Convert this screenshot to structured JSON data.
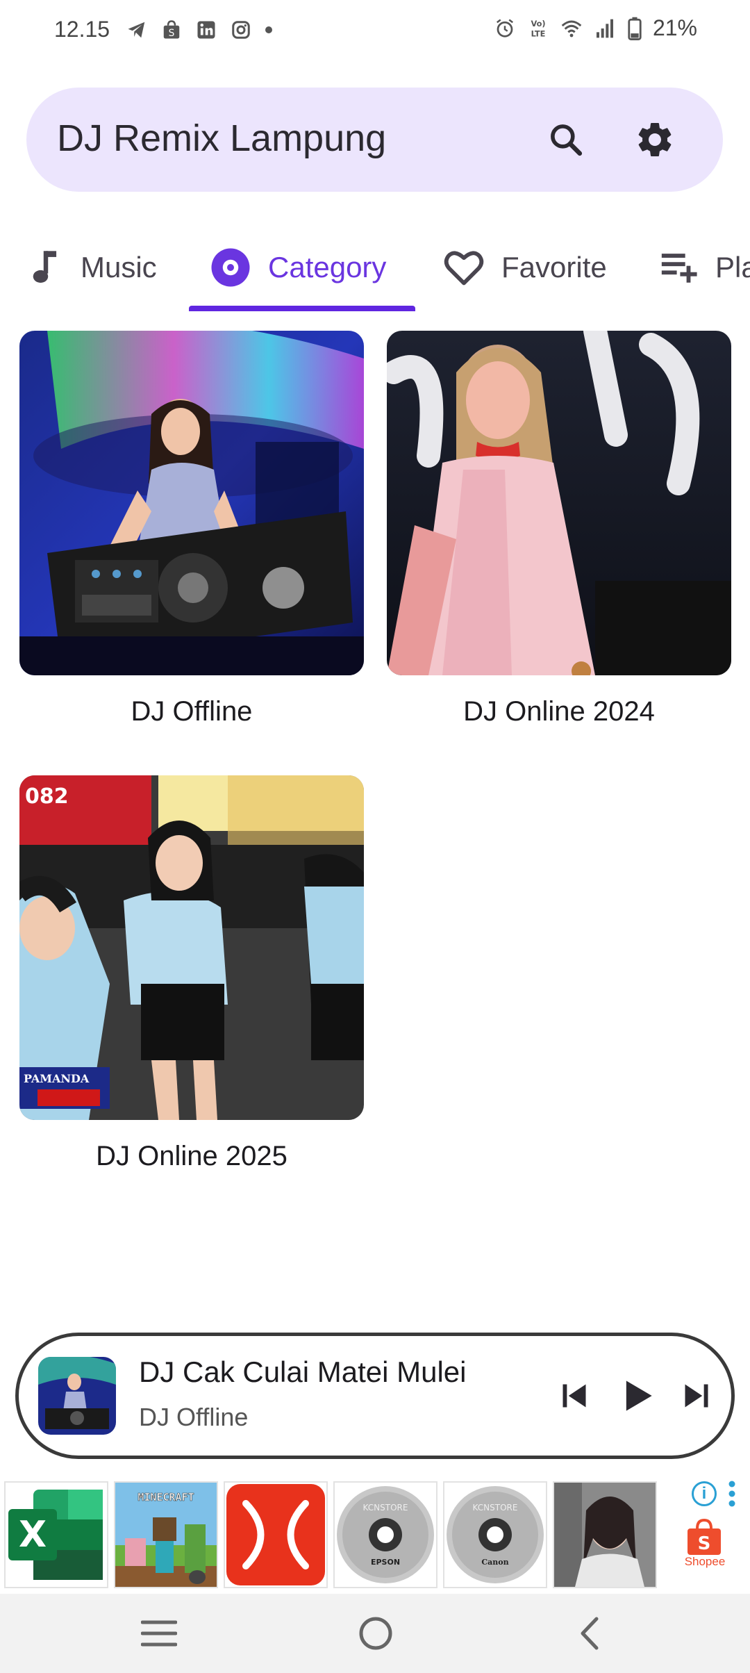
{
  "status_bar": {
    "time": "12.15",
    "battery": "21%",
    "left_icons": [
      "telegram-icon",
      "shopee-icon",
      "linkedin-icon",
      "instagram-icon",
      "dot-icon"
    ],
    "right_icons": [
      "alarm-icon",
      "volte-icon",
      "wifi-icon",
      "signal-icon",
      "battery-icon"
    ]
  },
  "search_bar": {
    "title": "DJ Remix Lampung",
    "search_icon": "search-icon",
    "settings_icon": "gear-icon"
  },
  "tabs": [
    {
      "label": "Music",
      "icon": "music-note-icon",
      "active": false
    },
    {
      "label": "Category",
      "icon": "disc-icon",
      "active": true
    },
    {
      "label": "Favorite",
      "icon": "heart-icon",
      "active": false
    },
    {
      "label": "Pla",
      "icon": "playlist-add-icon",
      "active": false
    }
  ],
  "categories": [
    {
      "label": "DJ Offline"
    },
    {
      "label": "DJ Online 2024"
    },
    {
      "label": "DJ Online 2025"
    }
  ],
  "mini_player": {
    "title": "DJ Cak Culai Matei Mulei",
    "subtitle": "DJ Offline"
  },
  "ads": {
    "tiles": [
      "excel-app",
      "minecraft-app",
      "xmind-app",
      "epson-cd",
      "canon-cd",
      "photo-app"
    ],
    "epson_text": "EPSON",
    "canon_text": "Canon",
    "store_text": "KCNSTORE",
    "minecraft_text": "MINECRAFT",
    "excel_letter": "X",
    "shopee_label": "Shopee",
    "info_label": "i"
  },
  "colors": {
    "accent": "#5f26e0",
    "search_bg": "#ece5fd"
  }
}
